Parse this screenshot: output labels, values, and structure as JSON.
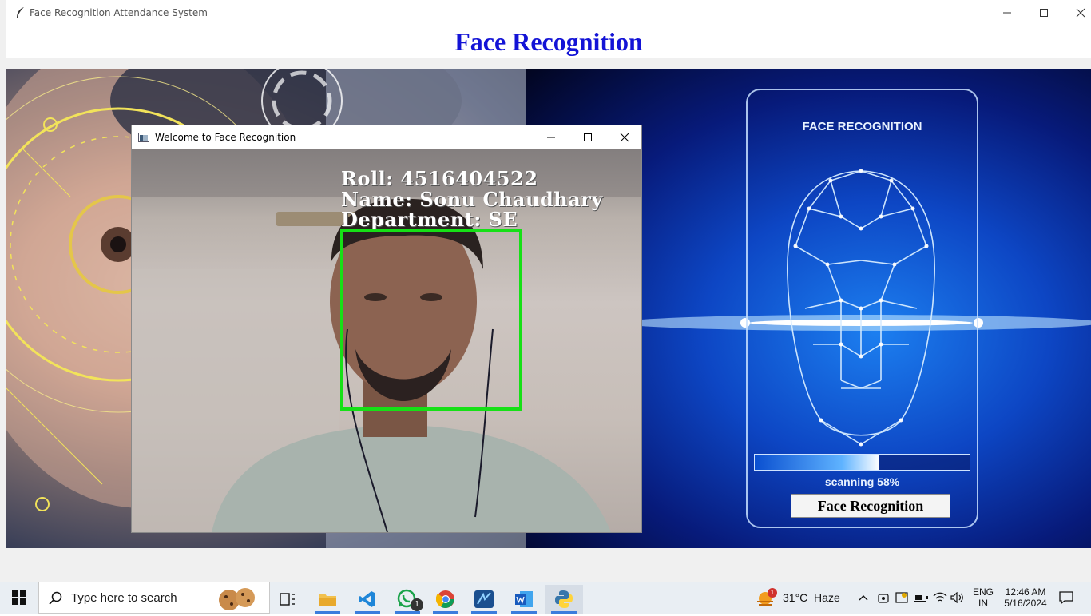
{
  "app_window": {
    "title": "Face Recognition Attendance System",
    "heading": "Face Recognition",
    "heading_color": "#1313d6"
  },
  "scan_panel": {
    "title": "FACE RECOGNITION",
    "progress_percent": 58,
    "scan_label": "scanning 58%",
    "button_label": "Face Recognition"
  },
  "camera_window": {
    "title": "Welcome to Face Recognition",
    "overlay": {
      "roll": "Roll: 4516404522",
      "name": "Name: Sonu Chaudhary",
      "department": "Department: SE"
    },
    "face_box_color": "#16e016"
  },
  "taskbar": {
    "search_placeholder": "Type here to search",
    "apps": [
      "task-view",
      "file-explorer",
      "vs-code",
      "whatsapp",
      "chrome",
      "network-tool",
      "word",
      "python"
    ],
    "whatsapp_badge": "1",
    "weather": "31°C  Haze",
    "weather_badge": "1",
    "language": "ENG",
    "region": "IN",
    "time": "12:46 AM",
    "date": "5/16/2024"
  },
  "colors": {
    "accent_blue": "#1313d6",
    "face_box_green": "#16e016",
    "taskbar_bg": "#e9eef3"
  }
}
